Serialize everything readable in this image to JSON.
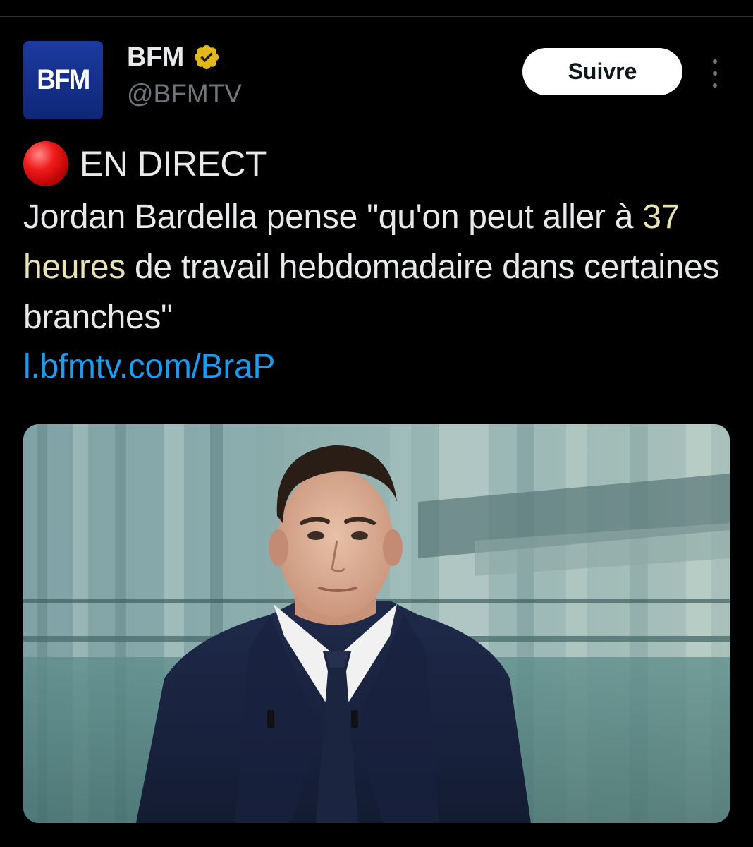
{
  "account": {
    "avatar_text": "BFM",
    "display_name": "BFM",
    "handle": "@BFMTV",
    "verified_icon": "verified-gold-badge-icon"
  },
  "actions": {
    "follow_label": "Suivre",
    "more_icon": "more-vertical-icon"
  },
  "tweet": {
    "live_icon": "red-circle-icon",
    "live_label": "EN DIRECT",
    "text_part1": "Jordan Bardella pense \"qu'on peut aller à ",
    "text_highlight": "37 heures",
    "text_part2": " de travail hebdomadaire dans certaines branches\"",
    "link": "l.bfmtv.com/BraP"
  },
  "colors": {
    "background": "#000000",
    "text": "#e7e9ea",
    "secondary_text": "#71767b",
    "link": "#1d9bf0",
    "highlight": "#e8e2b4",
    "verified_badge": "#e2b719",
    "avatar_bg": "#1c3aa0"
  }
}
